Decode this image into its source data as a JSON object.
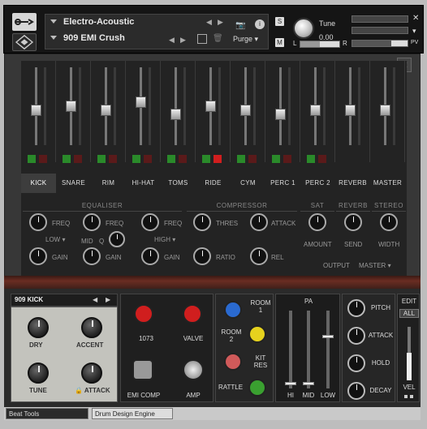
{
  "header": {
    "instrument": "Electro-Acoustic",
    "preset": "909 EMI Crush",
    "purge_label": "Purge",
    "solo_label": "S",
    "mute_label": "M",
    "tune_label": "Tune",
    "tune_value": "0.00",
    "pan_letters": {
      "left": "L",
      "right": "R"
    },
    "meter_pv": "PV"
  },
  "mixer": {
    "channels": [
      {
        "label": "KICK",
        "selected": true,
        "fader_level": 0.45
      },
      {
        "label": "SNARE",
        "selected": false,
        "fader_level": 0.5
      },
      {
        "label": "RIM",
        "selected": false,
        "fader_level": 0.45
      },
      {
        "label": "HI-HAT",
        "selected": false,
        "fader_level": 0.55
      },
      {
        "label": "TOMS",
        "selected": false,
        "fader_level": 0.4
      },
      {
        "label": "RIDE",
        "selected": false,
        "fader_level": 0.5,
        "mute_active": true
      },
      {
        "label": "CYM",
        "selected": false,
        "fader_level": 0.45
      },
      {
        "label": "PERC 1",
        "selected": false,
        "fader_level": 0.4
      },
      {
        "label": "PERC 2",
        "selected": false,
        "fader_level": 0.45
      },
      {
        "label": "REVERB",
        "selected": false,
        "fader_level": 0.45
      },
      {
        "label": "MASTER",
        "selected": false,
        "fader_level": 0.45
      }
    ],
    "sections": {
      "equaliser": "EQUALISER",
      "compressor": "COMPRESSOR",
      "sat": "SAT",
      "reverb": "REVERB",
      "stereo": "STEREO"
    },
    "eq": {
      "freq": "FREQ",
      "gain": "GAIN",
      "q": "Q",
      "low": "LOW",
      "mid": "MID",
      "high": "HIGH"
    },
    "comp": {
      "thres": "THRES",
      "attack": "ATTACK",
      "ratio": "RATIO",
      "rel": "REL"
    },
    "sat": {
      "amount": "AMOUNT"
    },
    "reverb": {
      "send": "SEND"
    },
    "stereo": {
      "width": "WIDTH"
    },
    "output": {
      "label": "OUTPUT",
      "value": "MASTER"
    }
  },
  "kick_panel": {
    "name": "909 KICK",
    "dry": "DRY",
    "accent": "ACCENT",
    "tune": "TUNE",
    "attack": "ATTACK"
  },
  "amp_panel": {
    "preamp": "1073",
    "valve": "VALVE",
    "emi_comp": "EMI COMP",
    "amp": "AMP"
  },
  "room_panel": {
    "room1": "ROOM\n1",
    "room2": "ROOM\n2",
    "kit_res": "KIT\nRES",
    "rattle": "RATTLE"
  },
  "pa_panel": {
    "title": "PA",
    "hi": "HI",
    "mid": "MID",
    "low": "LOW"
  },
  "env_panel": {
    "pitch": "PITCH",
    "attack": "ATTACK",
    "hold": "HOLD",
    "decay": "DECAY"
  },
  "edit_panel": {
    "edit": "EDIT",
    "all": "ALL",
    "vel": "VEL"
  },
  "status_bar": {
    "left": "Beat Tools",
    "right": "Drum Design Engine"
  },
  "colors": {
    "accent_red": "#d01e1e",
    "led_green": "#2a8a2a",
    "blue_knob": "#2a6ad0",
    "yellow_knob": "#e6d21e",
    "green_knob": "#3aa030",
    "pink_knob": "#d05a5a"
  }
}
